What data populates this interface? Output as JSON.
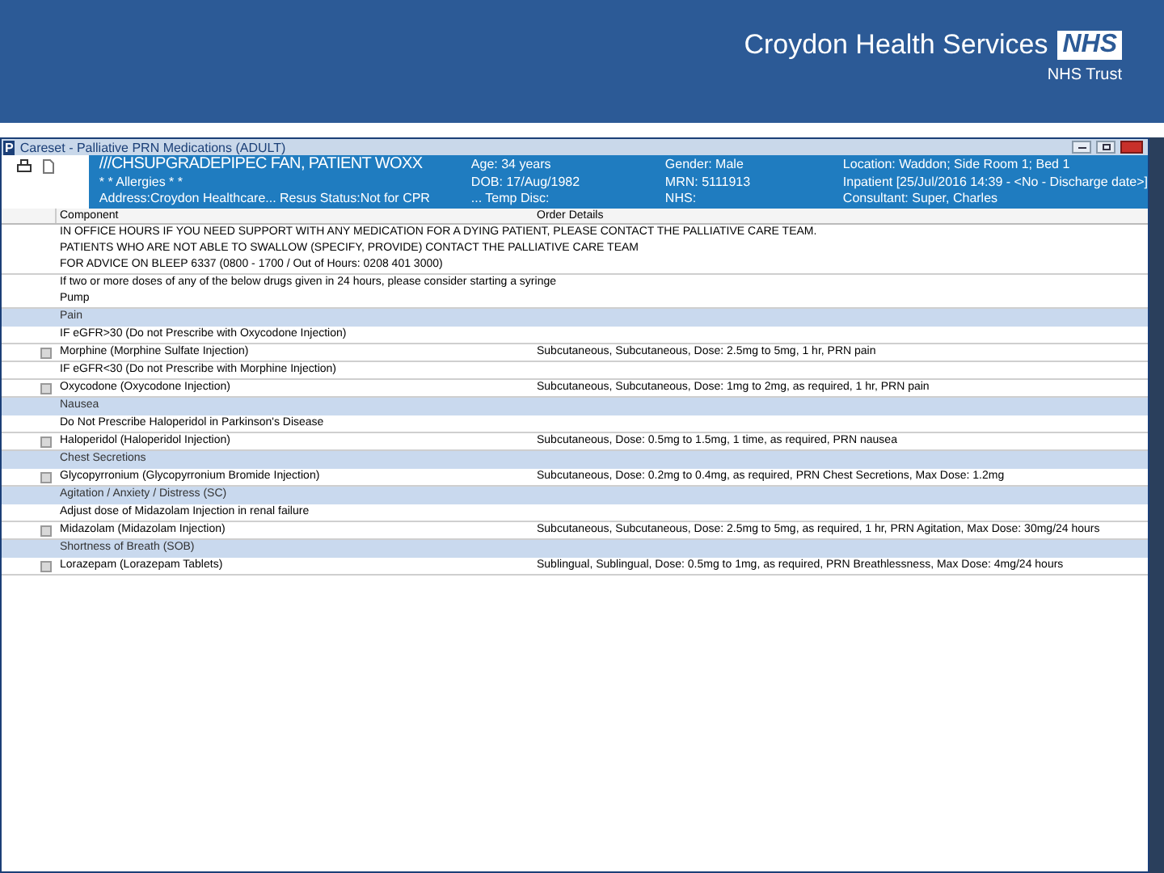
{
  "slide_header": {
    "organisation": "Croydon Health Services",
    "logo": "NHS",
    "trust": "NHS Trust"
  },
  "window": {
    "title": "Careset - Palliative PRN Medications (ADULT)",
    "app_letter": "P",
    "banner": {
      "left": [
        "///CHSUPGRADEPIPEC FAN, PATIENT WOXX",
        "* * Allergies * *",
        "Address:Croydon Healthcare... Resus Status:Not for CPR"
      ],
      "mid": [
        "Age: 34 years",
        "DOB: 17/Aug/1982",
        "... Temp Disc:"
      ],
      "mid2": [
        "Gender: Male",
        "MRN: 5111913",
        "NHS:"
      ],
      "right": [
        "Location: Waddon; Side Room 1; Bed 1",
        "Inpatient [25/Jul/2016 14:39 - <No - Discharge date>]",
        "Consultant: Super, Charles"
      ]
    },
    "table": {
      "columns": [
        "Component",
        "Order Details"
      ],
      "rows": [
        {
          "kind": "note",
          "component": "IN OFFICE HOURS IF YOU NEED SUPPORT WITH ANY MEDICATION FOR A DYING PATIENT, PLEASE CONTACT THE PALLIATIVE CARE TEAM.\nPATIENTS WHO ARE NOT ABLE TO SWALLOW (SPECIFY, PROVIDE) CONTACT THE PALLIATIVE CARE TEAM\nFOR ADVICE ON BLEEP 6337 (0800 - 1700 / Out of Hours: 0208 401 3000)"
        },
        {
          "kind": "note",
          "component": "If two or more doses of any of the below drugs given in 24 hours, please consider starting a syringe\nPump"
        },
        {
          "kind": "category",
          "component": "Pain"
        },
        {
          "kind": "note",
          "component": "IF eGFR>30 (Do not Prescribe with Oxycodone Injection)"
        },
        {
          "kind": "med",
          "checked": false,
          "component": "Morphine (Morphine Sulfate Injection)",
          "details": "Subcutaneous, Subcutaneous, Dose: 2.5mg to 5mg, 1 hr, PRN pain"
        },
        {
          "kind": "note",
          "component": "IF eGFR<30 (Do not Prescribe with Morphine Injection)"
        },
        {
          "kind": "med",
          "checked": false,
          "component": "Oxycodone (Oxycodone Injection)",
          "details": "Subcutaneous, Subcutaneous, Dose: 1mg to 2mg, as required, 1 hr, PRN pain"
        },
        {
          "kind": "category",
          "component": "Nausea"
        },
        {
          "kind": "note",
          "component": "Do Not Prescribe Haloperidol in Parkinson's Disease"
        },
        {
          "kind": "med",
          "checked": false,
          "component": "Haloperidol (Haloperidol Injection)",
          "details": "Subcutaneous, Dose: 0.5mg to 1.5mg, 1 time, as required, PRN nausea"
        },
        {
          "kind": "category",
          "component": "Chest Secretions"
        },
        {
          "kind": "med",
          "checked": false,
          "component": "Glycopyrronium (Glycopyrronium Bromide Injection)",
          "details": "Subcutaneous, Dose: 0.2mg to 0.4mg, as required, PRN Chest Secretions, Max Dose: 1.2mg"
        },
        {
          "kind": "category",
          "component": "Agitation / Anxiety / Distress (SC)"
        },
        {
          "kind": "note",
          "component": "Adjust dose of Midazolam Injection in renal failure"
        },
        {
          "kind": "med",
          "checked": false,
          "component": "Midazolam (Midazolam Injection)",
          "details": "Subcutaneous, Subcutaneous, Dose: 2.5mg to 5mg, as required, 1 hr, PRN Agitation, Max Dose: 30mg/24 hours"
        },
        {
          "kind": "category",
          "component": "Shortness of Breath (SOB)"
        },
        {
          "kind": "med",
          "checked": false,
          "component": "Lorazepam (Lorazepam Tablets)",
          "details": "Sublingual, Sublingual, Dose: 0.5mg to 1mg, as required, PRN Breathlessness, Max Dose: 4mg/24 hours"
        }
      ]
    }
  }
}
